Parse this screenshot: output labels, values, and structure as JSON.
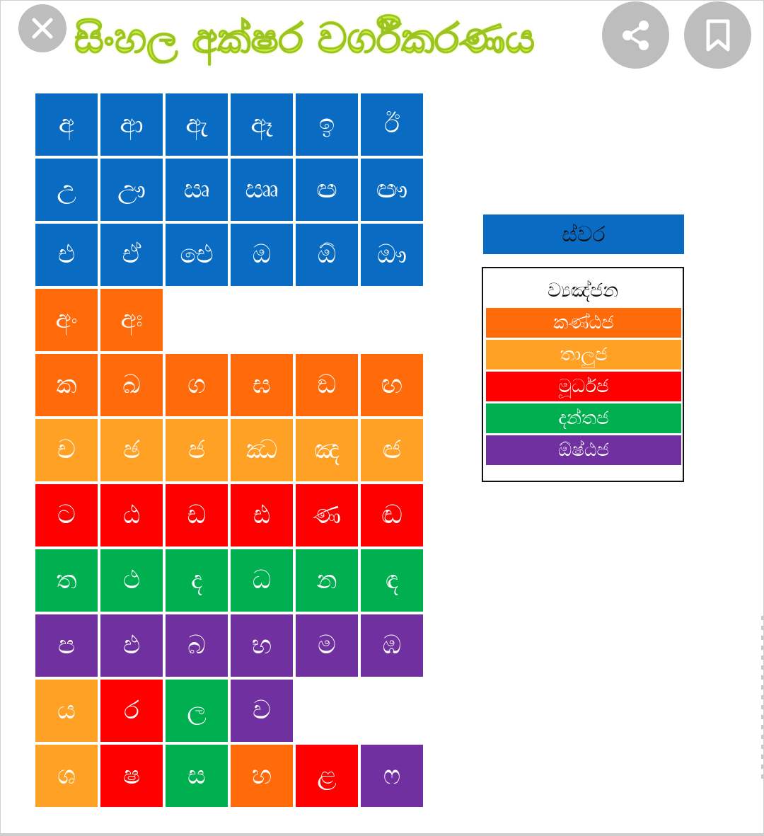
{
  "header": {
    "title": "සිංහල අක්ෂර වර්ගීකරණය",
    "title_color": "#c8ee3c",
    "close_icon": "close-icon",
    "share_icon": "share-icon",
    "bookmark_icon": "bookmark-icon"
  },
  "colors": {
    "swara": "#0a6bc2",
    "kantaja": "#ff6a0a",
    "taluja": "#ffa124",
    "murdhaja": "#fe0000",
    "dantaja": "#00b050",
    "oshthaja": "#7030a0",
    "button_gray": "#bdbdbd"
  },
  "grid": {
    "rows": [
      [
        {
          "c": "අ",
          "k": "swara"
        },
        {
          "c": "ආ",
          "k": "swara"
        },
        {
          "c": "ඇ",
          "k": "swara"
        },
        {
          "c": "ඈ",
          "k": "swara"
        },
        {
          "c": "ඉ",
          "k": "swara"
        },
        {
          "c": "ඊ",
          "k": "swara"
        }
      ],
      [
        {
          "c": "උ",
          "k": "swara"
        },
        {
          "c": "ඌ",
          "k": "swara"
        },
        {
          "c": "ඍ",
          "k": "swara"
        },
        {
          "c": "ඎ",
          "k": "swara"
        },
        {
          "c": "ඏ",
          "k": "swara"
        },
        {
          "c": "ඐ",
          "k": "swara"
        }
      ],
      [
        {
          "c": "එ",
          "k": "swara"
        },
        {
          "c": "ඒ",
          "k": "swara"
        },
        {
          "c": "ඓ",
          "k": "swara"
        },
        {
          "c": "ඔ",
          "k": "swara"
        },
        {
          "c": "ඕ",
          "k": "swara"
        },
        {
          "c": "ඖ",
          "k": "swara"
        }
      ],
      [
        {
          "c": "අං",
          "k": "kantaja"
        },
        {
          "c": "අඃ",
          "k": "kantaja"
        }
      ],
      [
        {
          "c": "ක",
          "k": "kantaja"
        },
        {
          "c": "ඛ",
          "k": "kantaja"
        },
        {
          "c": "ග",
          "k": "kantaja"
        },
        {
          "c": "ඝ",
          "k": "kantaja"
        },
        {
          "c": "ඞ",
          "k": "kantaja"
        },
        {
          "c": "ඟ",
          "k": "kantaja"
        }
      ],
      [
        {
          "c": "ච",
          "k": "taluja"
        },
        {
          "c": "ඡ",
          "k": "taluja"
        },
        {
          "c": "ජ",
          "k": "taluja"
        },
        {
          "c": "ඣ",
          "k": "taluja"
        },
        {
          "c": "ඤ",
          "k": "taluja"
        },
        {
          "c": "ඦ",
          "k": "taluja"
        }
      ],
      [
        {
          "c": "ට",
          "k": "murdhaja"
        },
        {
          "c": "ඨ",
          "k": "murdhaja"
        },
        {
          "c": "ඩ",
          "k": "murdhaja"
        },
        {
          "c": "ඪ",
          "k": "murdhaja"
        },
        {
          "c": "ණ",
          "k": "murdhaja"
        },
        {
          "c": "ඬ",
          "k": "murdhaja"
        }
      ],
      [
        {
          "c": "ත",
          "k": "dantaja"
        },
        {
          "c": "ථ",
          "k": "dantaja"
        },
        {
          "c": "ද",
          "k": "dantaja"
        },
        {
          "c": "ධ",
          "k": "dantaja"
        },
        {
          "c": "න",
          "k": "dantaja"
        },
        {
          "c": "ඳ",
          "k": "dantaja"
        }
      ],
      [
        {
          "c": "ප",
          "k": "oshthaja"
        },
        {
          "c": "ඵ",
          "k": "oshthaja"
        },
        {
          "c": "බ",
          "k": "oshthaja"
        },
        {
          "c": "භ",
          "k": "oshthaja"
        },
        {
          "c": "ම",
          "k": "oshthaja"
        },
        {
          "c": "ඹ",
          "k": "oshthaja"
        }
      ],
      [
        {
          "c": "ය",
          "k": "taluja"
        },
        {
          "c": "ර",
          "k": "murdhaja"
        },
        {
          "c": "ල",
          "k": "dantaja"
        },
        {
          "c": "ව",
          "k": "oshthaja"
        }
      ],
      [
        {
          "c": "ශ",
          "k": "taluja"
        },
        {
          "c": "ෂ",
          "k": "murdhaja"
        },
        {
          "c": "ස",
          "k": "dantaja"
        },
        {
          "c": "හ",
          "k": "kantaja"
        },
        {
          "c": "ළ",
          "k": "murdhaja"
        },
        {
          "c": "ෆ",
          "k": "oshthaja"
        }
      ]
    ]
  },
  "legend": {
    "swara_label": "ස්වර",
    "vyanjana_title": "ව්‍යඤ්ජන",
    "items": [
      {
        "label": "කණ්ඨජ",
        "k": "kantaja"
      },
      {
        "label": "තාලුජ",
        "k": "taluja"
      },
      {
        "label": "මූර්ධජ",
        "k": "murdhaja"
      },
      {
        "label": "දන්තජ",
        "k": "dantaja"
      },
      {
        "label": "ඕෂ්ඨජ",
        "k": "oshthaja"
      }
    ]
  }
}
